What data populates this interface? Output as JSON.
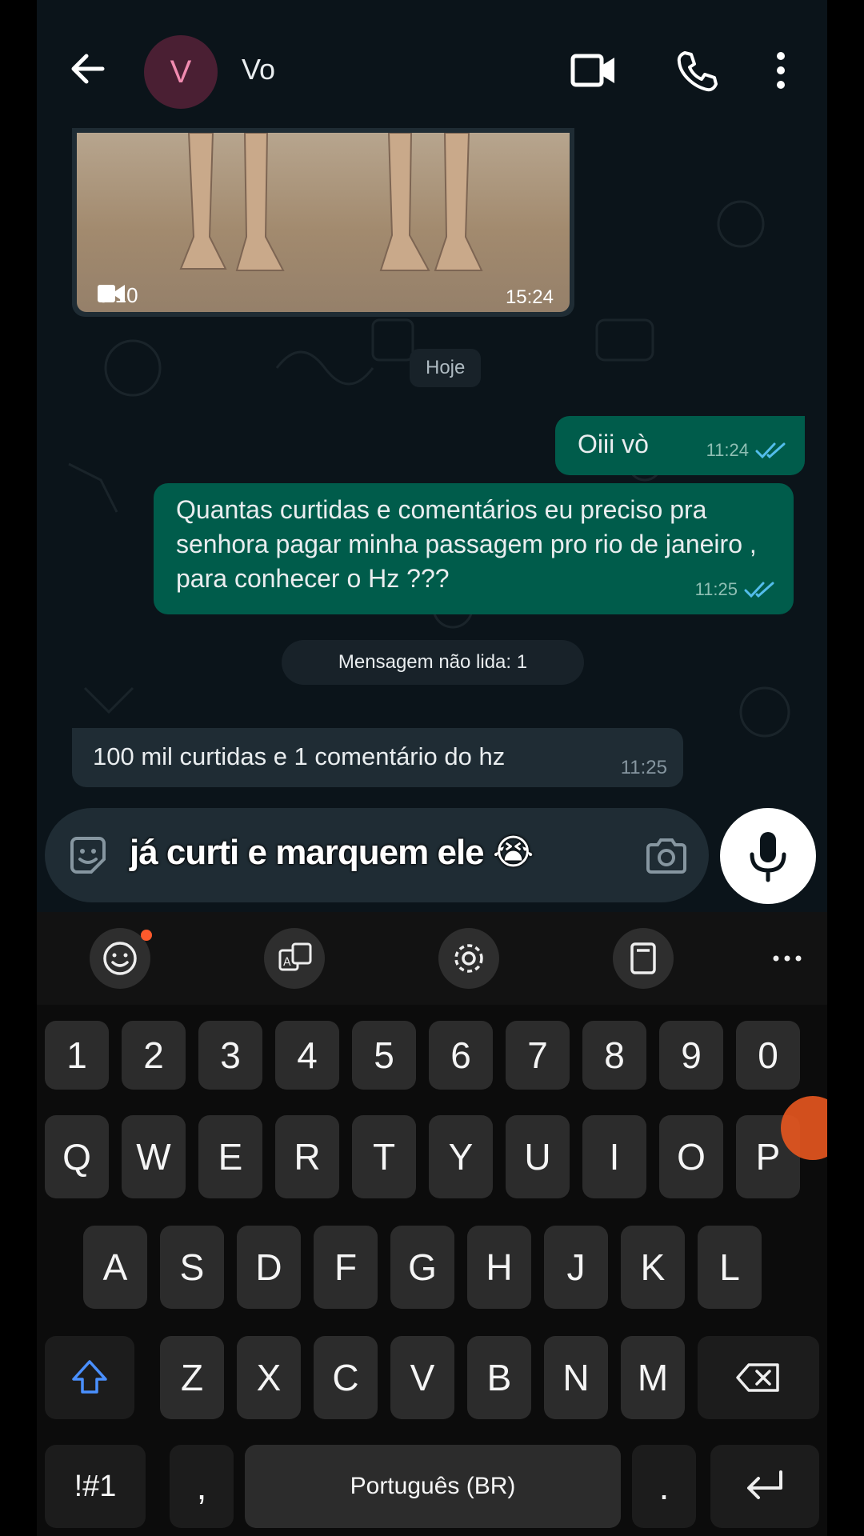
{
  "header": {
    "avatar_letter": "V",
    "contact_name": "Vo"
  },
  "chat": {
    "video_message": {
      "duration": "0:10",
      "time": "15:24"
    },
    "date_label": "Hoje",
    "outgoing": [
      {
        "text": "Oiii vò",
        "time": "11:24",
        "status": "read"
      },
      {
        "text": "Quantas curtidas e comentários eu preciso pra senhora pagar minha passagem pro rio de janeiro , para conhecer o Hz ???",
        "time": "11:25",
        "status": "read"
      }
    ],
    "unread_label": "Mensagem não lida: 1",
    "incoming": [
      {
        "text": "100 mil curtidas e 1 comentário do hz",
        "time": "11:25"
      }
    ]
  },
  "composer": {
    "caption_overlay": "já curti e marquem ele 😭"
  },
  "keyboard": {
    "toolbar": [
      "emoji-icon",
      "translate-icon",
      "gear-icon",
      "clipboard-icon",
      "more-icon"
    ],
    "numbers": [
      "1",
      "2",
      "3",
      "4",
      "5",
      "6",
      "7",
      "8",
      "9",
      "0"
    ],
    "row1": [
      "Q",
      "W",
      "E",
      "R",
      "T",
      "Y",
      "U",
      "I",
      "O",
      "P"
    ],
    "row2": [
      "A",
      "S",
      "D",
      "F",
      "G",
      "H",
      "J",
      "K",
      "L"
    ],
    "row3": [
      "Z",
      "X",
      "C",
      "V",
      "B",
      "N",
      "M"
    ],
    "symbols_key": "!#1",
    "comma_key": ",",
    "space_label": "Português (BR)",
    "period_key": "."
  },
  "colors": {
    "outgoing_bubble": "#005c4b",
    "incoming_bubble": "#1f2c34",
    "read_ticks": "#53bdeb",
    "background": "#0b141a"
  }
}
